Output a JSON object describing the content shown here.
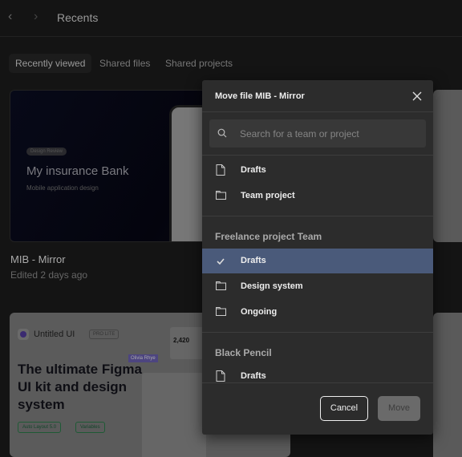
{
  "header": {
    "title": "Recents",
    "back_icon": "chevron-left-icon",
    "forward_icon": "chevron-right-icon"
  },
  "tabs": [
    {
      "label": "Recently viewed",
      "active": true
    },
    {
      "label": "Shared files"
    },
    {
      "label": "Shared projects"
    }
  ],
  "files": [
    {
      "name": "MIB - Mirror",
      "edited": "Edited 2 days ago",
      "thumbnail": {
        "badge": "Design Review",
        "title": "My insurance Bank",
        "subtitle": "Mobile application design"
      }
    },
    {
      "thumbnail": {
        "brand": "Untitled UI",
        "badge": "PRO LITE",
        "headline": "The ultimate Figma UI kit and design system",
        "chips": [
          "Auto Layout 5.0",
          "Variables"
        ],
        "cursor_label": "Olivia Rhye",
        "stat": "2,420"
      }
    }
  ],
  "modal": {
    "title": "Move file MIB - Mirror",
    "search_placeholder": "Search for a team or project",
    "top_items": [
      {
        "label": "Drafts",
        "icon": "file-icon"
      },
      {
        "label": "Team project",
        "icon": "folder-icon"
      }
    ],
    "sections": [
      {
        "title": "Freelance project Team",
        "items": [
          {
            "label": "Drafts",
            "icon": "check-icon",
            "selected": true
          },
          {
            "label": "Design system",
            "icon": "folder-icon"
          },
          {
            "label": "Ongoing",
            "icon": "folder-icon"
          }
        ]
      },
      {
        "title": "Black Pencil",
        "items": [
          {
            "label": "Drafts",
            "icon": "file-icon"
          }
        ]
      }
    ],
    "cancel_label": "Cancel",
    "move_label": "Move",
    "move_enabled": false,
    "selected_color": "#4a5a7a"
  }
}
